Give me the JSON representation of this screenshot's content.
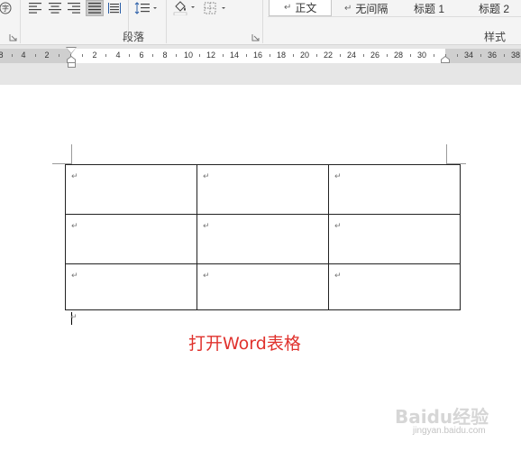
{
  "ribbon": {
    "paragraph_group": {
      "label": "段落",
      "buttons": [
        {
          "name": "align-left-button",
          "icon": "align-left-icon"
        },
        {
          "name": "align-center-button",
          "icon": "align-center-icon"
        },
        {
          "name": "align-right-button",
          "icon": "align-right-icon"
        },
        {
          "name": "justify-button",
          "icon": "justify-icon",
          "active": true
        },
        {
          "name": "distribute-button",
          "icon": "distributed-align-icon"
        },
        {
          "name": "line-spacing-button",
          "icon": "line-spacing-icon"
        },
        {
          "name": "shading-button",
          "icon": "paint-bucket-icon"
        },
        {
          "name": "borders-button",
          "icon": "border-icon"
        }
      ]
    },
    "font_group": {
      "phonetic_guide_glyph": "字"
    },
    "styles_group": {
      "label": "样式",
      "items": [
        {
          "label": "正文",
          "mark": "↵"
        },
        {
          "label": "无间隔",
          "mark": "↵"
        },
        {
          "label": "标题 1",
          "mark": ""
        },
        {
          "label": "标题 2",
          "mark": ""
        }
      ]
    }
  },
  "ruler": {
    "labels": [
      "8",
      "4",
      "2",
      "2",
      "4",
      "6",
      "8",
      "10",
      "12",
      "14",
      "16",
      "18",
      "20",
      "22",
      "24",
      "26",
      "28",
      "30",
      "34",
      "36",
      "38"
    ]
  },
  "document": {
    "table": {
      "rows": 3,
      "cols": 3,
      "cell_mark": "↵"
    },
    "after_table_mark": "↵",
    "caption": "打开Word表格"
  },
  "watermark": {
    "text": "Baidu经验",
    "url": "jingyan.baidu.com"
  },
  "colors": {
    "caption": "#e0322d",
    "ribbon_bg": "#f4f4f4",
    "ruler_margin": "#cfcfcf"
  }
}
